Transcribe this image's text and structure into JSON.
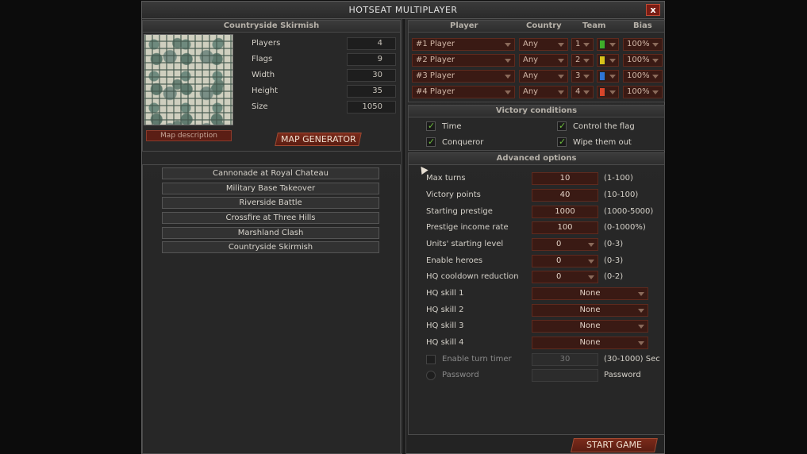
{
  "window": {
    "title": "HOTSEAT MULTIPLAYER",
    "close_label": "x"
  },
  "map": {
    "header": "Countryside Skirmish",
    "info": [
      {
        "label": "Players",
        "value": "4"
      },
      {
        "label": "Flags",
        "value": "9"
      },
      {
        "label": "Width",
        "value": "30"
      },
      {
        "label": "Height",
        "value": "35"
      },
      {
        "label": "Size",
        "value": "1050"
      }
    ],
    "description_label": "Map description",
    "generator_label": "MAP GENERATOR"
  },
  "scenarios": [
    "Cannonade at Royal Chateau",
    "Military Base Takeover",
    "Riverside Battle",
    "Crossfire at Three Hills",
    "Marshland Clash",
    "Countryside Skirmish"
  ],
  "players": {
    "headers": {
      "player": "Player",
      "country": "Country",
      "team": "Team",
      "bias": "Bias"
    },
    "rows": [
      {
        "name": "#1 Player",
        "country": "Any",
        "team": "1",
        "color": "#3fae2a",
        "bias": "100%"
      },
      {
        "name": "#2 Player",
        "country": "Any",
        "team": "2",
        "color": "#d8c21a",
        "bias": "100%"
      },
      {
        "name": "#3 Player",
        "country": "Any",
        "team": "3",
        "color": "#2f74d6",
        "bias": "100%"
      },
      {
        "name": "#4 Player",
        "country": "Any",
        "team": "4",
        "color": "#d8452a",
        "bias": "100%"
      }
    ]
  },
  "victory": {
    "header": "Victory conditions",
    "items": [
      {
        "label": "Time",
        "checked": true
      },
      {
        "label": "Control the flag",
        "checked": true
      },
      {
        "label": "Conqueror",
        "checked": true
      },
      {
        "label": "Wipe them out",
        "checked": true
      }
    ]
  },
  "advanced": {
    "header": "Advanced options",
    "rows": [
      {
        "label": "Max turns",
        "value": "10",
        "range": "(1-100)"
      },
      {
        "label": "Victory points",
        "value": "40",
        "range": "(10-100)"
      },
      {
        "label": "Starting prestige",
        "value": "1000",
        "range": "(1000-5000)"
      },
      {
        "label": "Prestige income rate",
        "value": "100",
        "range": "(0-1000%)"
      },
      {
        "label": "Units' starting level",
        "value": "0",
        "range": "(0-3)"
      },
      {
        "label": "Enable heroes",
        "value": "0",
        "range": "(0-3)"
      },
      {
        "label": "HQ cooldown reduction",
        "value": "0",
        "range": "(0-2)"
      },
      {
        "label": "HQ skill 1",
        "value": "None"
      },
      {
        "label": "HQ skill 2",
        "value": "None"
      },
      {
        "label": "HQ skill 3",
        "value": "None"
      },
      {
        "label": "HQ skill 4",
        "value": "None"
      }
    ],
    "turn_timer": {
      "label": "Enable turn timer",
      "value": "30",
      "range": "(30-1000) Sec"
    },
    "password": {
      "label": "Password",
      "value": "",
      "side_label": "Password"
    }
  },
  "start_label": "START GAME"
}
